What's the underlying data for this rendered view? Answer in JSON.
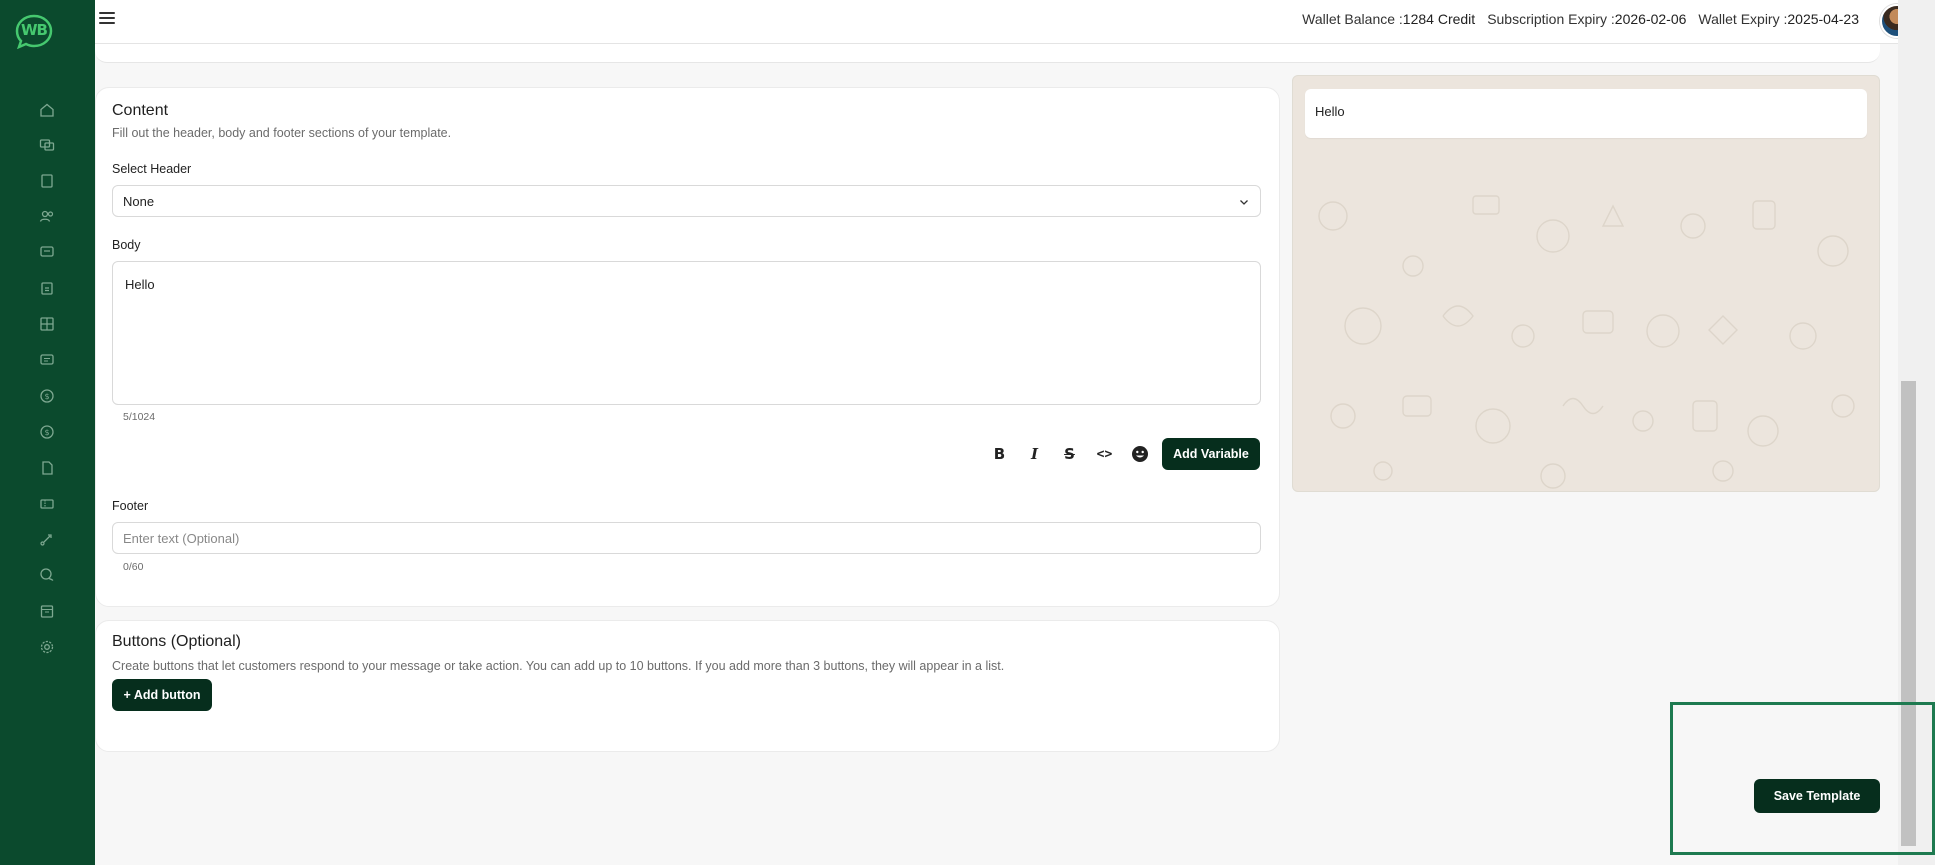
{
  "brand": {
    "logo_text": "WB",
    "accent": "#0b4a2d",
    "button_color": "#062e1d"
  },
  "sidebar": {
    "items": [
      {
        "icon": "home-icon"
      },
      {
        "icon": "chats-icon"
      },
      {
        "icon": "book-icon"
      },
      {
        "icon": "contacts-icon"
      },
      {
        "icon": "message-icon"
      },
      {
        "icon": "clipboard-icon"
      },
      {
        "icon": "grid-icon"
      },
      {
        "icon": "chat-bubble-icon"
      },
      {
        "icon": "dollar-icon"
      },
      {
        "icon": "dollar-circle-icon"
      },
      {
        "icon": "document-icon"
      },
      {
        "icon": "ticket-icon"
      },
      {
        "icon": "route-icon"
      },
      {
        "icon": "conversation-icon"
      },
      {
        "icon": "calendar-icon"
      },
      {
        "icon": "settings-icon"
      }
    ]
  },
  "topbar": {
    "wallet_balance_label": "Wallet Balance :",
    "wallet_balance_value": "1284 Credit",
    "subscription_expiry_label": "Subscription Expiry :",
    "subscription_expiry_value": "2026-02-06",
    "wallet_expiry_label": "Wallet Expiry :",
    "wallet_expiry_value": "2025-04-23"
  },
  "content": {
    "title": "Content",
    "subtitle": "Fill out the header, body and footer sections of your template.",
    "header_label": "Select Header",
    "header_value": "None",
    "body_label": "Body",
    "body_value": "Hello",
    "body_counter": "5/1024",
    "add_variable": "Add Variable",
    "footer_label": "Footer",
    "footer_placeholder": "Enter text (Optional)",
    "footer_counter": "0/60",
    "format_tools": {
      "bold": "B",
      "italic": "I",
      "strike": "S",
      "code": "<>"
    }
  },
  "buttons_section": {
    "title": "Buttons (Optional)",
    "subtitle": "Create buttons that let customers respond to your message or take action. You can add up to 10 buttons. If you add more than 3 buttons, they will appear in a list.",
    "add_button": "+ Add button"
  },
  "preview": {
    "message": "Hello"
  },
  "actions": {
    "save_template": "Save Template"
  }
}
